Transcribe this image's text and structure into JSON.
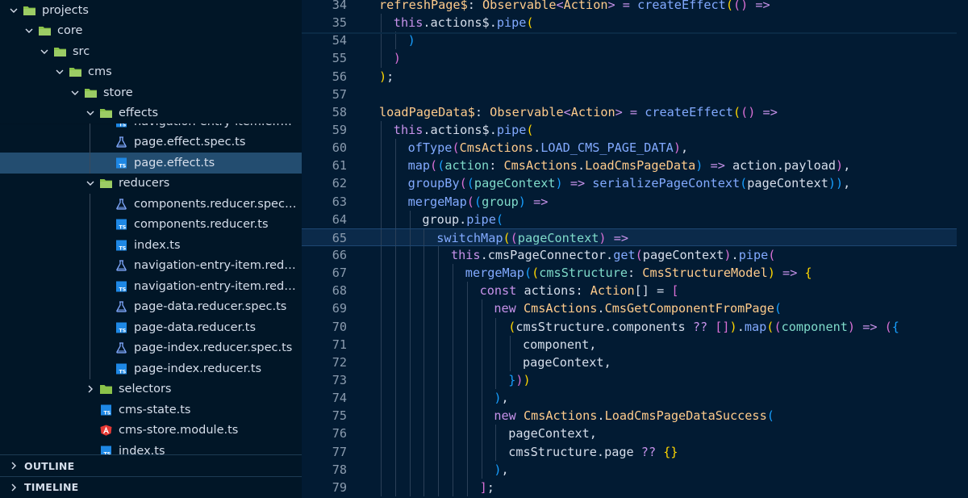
{
  "explorer": {
    "tree_top": [
      {
        "label": "projects",
        "kind": "folder",
        "expanded": true,
        "depth": 0
      },
      {
        "label": "core",
        "kind": "folder",
        "expanded": true,
        "depth": 1
      },
      {
        "label": "src",
        "kind": "folder",
        "expanded": true,
        "depth": 2
      },
      {
        "label": "cms",
        "kind": "folder",
        "expanded": true,
        "depth": 3
      },
      {
        "label": "store",
        "kind": "folder",
        "expanded": true,
        "depth": 4
      },
      {
        "label": "effects",
        "kind": "folder",
        "expanded": true,
        "depth": 5
      }
    ],
    "tree_bottom": [
      {
        "label": "navigation-entry-item.effect.ts",
        "kind": "ts",
        "depth": 6,
        "selected": false
      },
      {
        "label": "page.effect.spec.ts",
        "kind": "spec",
        "depth": 6,
        "selected": false
      },
      {
        "label": "page.effect.ts",
        "kind": "ts",
        "depth": 6,
        "selected": true
      },
      {
        "label": "reducers",
        "kind": "folder",
        "expanded": true,
        "depth": 5
      },
      {
        "label": "components.reducer.spec.ts",
        "kind": "spec",
        "depth": 6
      },
      {
        "label": "components.reducer.ts",
        "kind": "ts",
        "depth": 6
      },
      {
        "label": "index.ts",
        "kind": "ts",
        "depth": 6
      },
      {
        "label": "navigation-entry-item.reducer.spec.ts",
        "kind": "spec",
        "depth": 6
      },
      {
        "label": "navigation-entry-item.reducer.ts",
        "kind": "ts",
        "depth": 6
      },
      {
        "label": "page-data.reducer.spec.ts",
        "kind": "spec",
        "depth": 6
      },
      {
        "label": "page-data.reducer.ts",
        "kind": "ts",
        "depth": 6
      },
      {
        "label": "page-index.reducer.spec.ts",
        "kind": "spec",
        "depth": 6
      },
      {
        "label": "page-index.reducer.ts",
        "kind": "ts",
        "depth": 6
      },
      {
        "label": "selectors",
        "kind": "folder",
        "expanded": false,
        "depth": 5
      },
      {
        "label": "cms-state.ts",
        "kind": "ts",
        "depth": 5
      },
      {
        "label": "cms-store.module.ts",
        "kind": "angular",
        "depth": 5
      },
      {
        "label": "index.ts",
        "kind": "ts",
        "depth": 5
      }
    ],
    "panels": [
      {
        "label": "OUTLINE"
      },
      {
        "label": "TIMELINE"
      }
    ],
    "icon_ts_text": "TS"
  },
  "editor": {
    "current_line": 65,
    "lines": [
      {
        "n": "34",
        "indent": 0,
        "tokens": [
          [
            "prop",
            "refreshPage$"
          ],
          [
            "punc",
            ": "
          ],
          [
            "type",
            "Observable"
          ],
          [
            "op",
            "<"
          ],
          [
            "type",
            "Action"
          ],
          [
            "op",
            "> = "
          ],
          [
            "fn",
            "createEffect"
          ],
          [
            "p1",
            "("
          ],
          [
            "p2",
            "()"
          ],
          [
            "op",
            " => "
          ]
        ]
      },
      {
        "n": "35",
        "indent": 1,
        "tokens": [
          [
            "kw",
            "this"
          ],
          [
            "punc",
            "."
          ],
          [
            "var",
            "actions$"
          ],
          [
            "punc",
            "."
          ],
          [
            "fn",
            "pipe"
          ],
          [
            "p1",
            "("
          ]
        ]
      },
      {
        "n": "54",
        "indent": 2,
        "tokens": [
          [
            "p3",
            ")"
          ]
        ]
      },
      {
        "n": "55",
        "indent": 1,
        "tokens": [
          [
            "p2",
            ")"
          ]
        ]
      },
      {
        "n": "56",
        "indent": 0,
        "tokens": [
          [
            "p1",
            ")"
          ],
          [
            "punc",
            ";"
          ]
        ]
      },
      {
        "n": "57",
        "indent": 0,
        "tokens": []
      },
      {
        "n": "58",
        "indent": 0,
        "tokens": [
          [
            "prop",
            "loadPageData$"
          ],
          [
            "punc",
            ": "
          ],
          [
            "type",
            "Observable"
          ],
          [
            "op",
            "<"
          ],
          [
            "type",
            "Action"
          ],
          [
            "op",
            "> = "
          ],
          [
            "fn",
            "createEffect"
          ],
          [
            "p1",
            "("
          ],
          [
            "p2",
            "()"
          ],
          [
            "op",
            " => "
          ]
        ]
      },
      {
        "n": "59",
        "indent": 1,
        "tokens": [
          [
            "kw",
            "this"
          ],
          [
            "punc",
            "."
          ],
          [
            "var",
            "actions$"
          ],
          [
            "punc",
            "."
          ],
          [
            "fn",
            "pipe"
          ],
          [
            "p1",
            "("
          ]
        ]
      },
      {
        "n": "60",
        "indent": 2,
        "tokens": [
          [
            "fn",
            "ofType"
          ],
          [
            "p2",
            "("
          ],
          [
            "type",
            "CmsActions"
          ],
          [
            "punc",
            "."
          ],
          [
            "const",
            "LOAD_CMS_PAGE_DATA"
          ],
          [
            "p2",
            ")"
          ],
          [
            "punc",
            ","
          ]
        ]
      },
      {
        "n": "61",
        "indent": 2,
        "tokens": [
          [
            "fn",
            "map"
          ],
          [
            "p2",
            "("
          ],
          [
            "p3",
            "("
          ],
          [
            "param",
            "action"
          ],
          [
            "punc",
            ": "
          ],
          [
            "type",
            "CmsActions"
          ],
          [
            "punc",
            "."
          ],
          [
            "type",
            "LoadCmsPageData"
          ],
          [
            "p3",
            ")"
          ],
          [
            "op",
            " => "
          ],
          [
            "var",
            "action"
          ],
          [
            "punc",
            "."
          ],
          [
            "var",
            "payload"
          ],
          [
            "p2",
            ")"
          ],
          [
            "punc",
            ","
          ]
        ]
      },
      {
        "n": "62",
        "indent": 2,
        "tokens": [
          [
            "fn",
            "groupBy"
          ],
          [
            "p2",
            "("
          ],
          [
            "p3",
            "("
          ],
          [
            "param",
            "pageContext"
          ],
          [
            "p3",
            ")"
          ],
          [
            "op",
            " => "
          ],
          [
            "fn",
            "serializePageContext"
          ],
          [
            "p3",
            "("
          ],
          [
            "var",
            "pageContext"
          ],
          [
            "p3",
            "))"
          ],
          [
            "punc",
            ","
          ]
        ]
      },
      {
        "n": "63",
        "indent": 2,
        "tokens": [
          [
            "fn",
            "mergeMap"
          ],
          [
            "p2",
            "("
          ],
          [
            "p3",
            "("
          ],
          [
            "param",
            "group"
          ],
          [
            "p3",
            ")"
          ],
          [
            "op",
            " =>"
          ]
        ]
      },
      {
        "n": "64",
        "indent": 3,
        "tokens": [
          [
            "var",
            "group"
          ],
          [
            "punc",
            "."
          ],
          [
            "fn",
            "pipe"
          ],
          [
            "p3",
            "("
          ]
        ]
      },
      {
        "n": "65",
        "indent": 4,
        "tokens": [
          [
            "fn",
            "switchMap"
          ],
          [
            "p1",
            "("
          ],
          [
            "p2",
            "("
          ],
          [
            "param",
            "pageContext"
          ],
          [
            "p2",
            ")"
          ],
          [
            "op",
            " =>"
          ]
        ]
      },
      {
        "n": "66",
        "indent": 5,
        "tokens": [
          [
            "kw",
            "this"
          ],
          [
            "punc",
            "."
          ],
          [
            "var",
            "cmsPageConnector"
          ],
          [
            "punc",
            "."
          ],
          [
            "fn",
            "get"
          ],
          [
            "p2",
            "("
          ],
          [
            "var",
            "pageContext"
          ],
          [
            "p2",
            ")"
          ],
          [
            "punc",
            "."
          ],
          [
            "fn",
            "pipe"
          ],
          [
            "p2",
            "("
          ]
        ]
      },
      {
        "n": "67",
        "indent": 6,
        "tokens": [
          [
            "fn",
            "mergeMap"
          ],
          [
            "p3",
            "("
          ],
          [
            "p1",
            "("
          ],
          [
            "param",
            "cmsStructure"
          ],
          [
            "punc",
            ": "
          ],
          [
            "type",
            "CmsStructureModel"
          ],
          [
            "p1",
            ")"
          ],
          [
            "op",
            " => "
          ],
          [
            "p1",
            "{"
          ]
        ]
      },
      {
        "n": "68",
        "indent": 7,
        "tokens": [
          [
            "kw",
            "const "
          ],
          [
            "var",
            "actions"
          ],
          [
            "punc",
            ": "
          ],
          [
            "type",
            "Action"
          ],
          [
            "punc",
            "[] = "
          ],
          [
            "p2",
            "["
          ]
        ]
      },
      {
        "n": "69",
        "indent": 8,
        "tokens": [
          [
            "kw",
            "new "
          ],
          [
            "type",
            "CmsActions"
          ],
          [
            "punc",
            "."
          ],
          [
            "type",
            "CmsGetComponentFromPage"
          ],
          [
            "p3",
            "("
          ]
        ]
      },
      {
        "n": "70",
        "indent": 9,
        "tokens": [
          [
            "p1",
            "("
          ],
          [
            "var",
            "cmsStructure"
          ],
          [
            "punc",
            "."
          ],
          [
            "var",
            "components"
          ],
          [
            "op",
            " ?? "
          ],
          [
            "p2",
            "[]"
          ],
          [
            "p1",
            ")"
          ],
          [
            "punc",
            "."
          ],
          [
            "fn",
            "map"
          ],
          [
            "p1",
            "("
          ],
          [
            "p2",
            "("
          ],
          [
            "param",
            "component"
          ],
          [
            "p2",
            ")"
          ],
          [
            "op",
            " => "
          ],
          [
            "p2",
            "("
          ],
          [
            "p3",
            "{"
          ]
        ]
      },
      {
        "n": "71",
        "indent": 10,
        "tokens": [
          [
            "var",
            "component"
          ],
          [
            "punc",
            ","
          ]
        ]
      },
      {
        "n": "72",
        "indent": 10,
        "tokens": [
          [
            "var",
            "pageContext"
          ],
          [
            "punc",
            ","
          ]
        ]
      },
      {
        "n": "73",
        "indent": 9,
        "tokens": [
          [
            "p3",
            "}"
          ],
          [
            "p2",
            ")"
          ],
          [
            "p1",
            ")"
          ]
        ]
      },
      {
        "n": "74",
        "indent": 8,
        "tokens": [
          [
            "p3",
            ")"
          ],
          [
            "punc",
            ","
          ]
        ]
      },
      {
        "n": "75",
        "indent": 8,
        "tokens": [
          [
            "kw",
            "new "
          ],
          [
            "type",
            "CmsActions"
          ],
          [
            "punc",
            "."
          ],
          [
            "type",
            "LoadCmsPageDataSuccess"
          ],
          [
            "p3",
            "("
          ]
        ]
      },
      {
        "n": "76",
        "indent": 9,
        "tokens": [
          [
            "var",
            "pageContext"
          ],
          [
            "punc",
            ","
          ]
        ]
      },
      {
        "n": "77",
        "indent": 9,
        "tokens": [
          [
            "var",
            "cmsStructure"
          ],
          [
            "punc",
            "."
          ],
          [
            "var",
            "page"
          ],
          [
            "op",
            " ?? "
          ],
          [
            "p1",
            "{}"
          ]
        ]
      },
      {
        "n": "78",
        "indent": 8,
        "tokens": [
          [
            "p3",
            ")"
          ],
          [
            "punc",
            ","
          ]
        ]
      },
      {
        "n": "79",
        "indent": 7,
        "tokens": [
          [
            "p2",
            "]"
          ],
          [
            "punc",
            ";"
          ]
        ]
      }
    ]
  }
}
